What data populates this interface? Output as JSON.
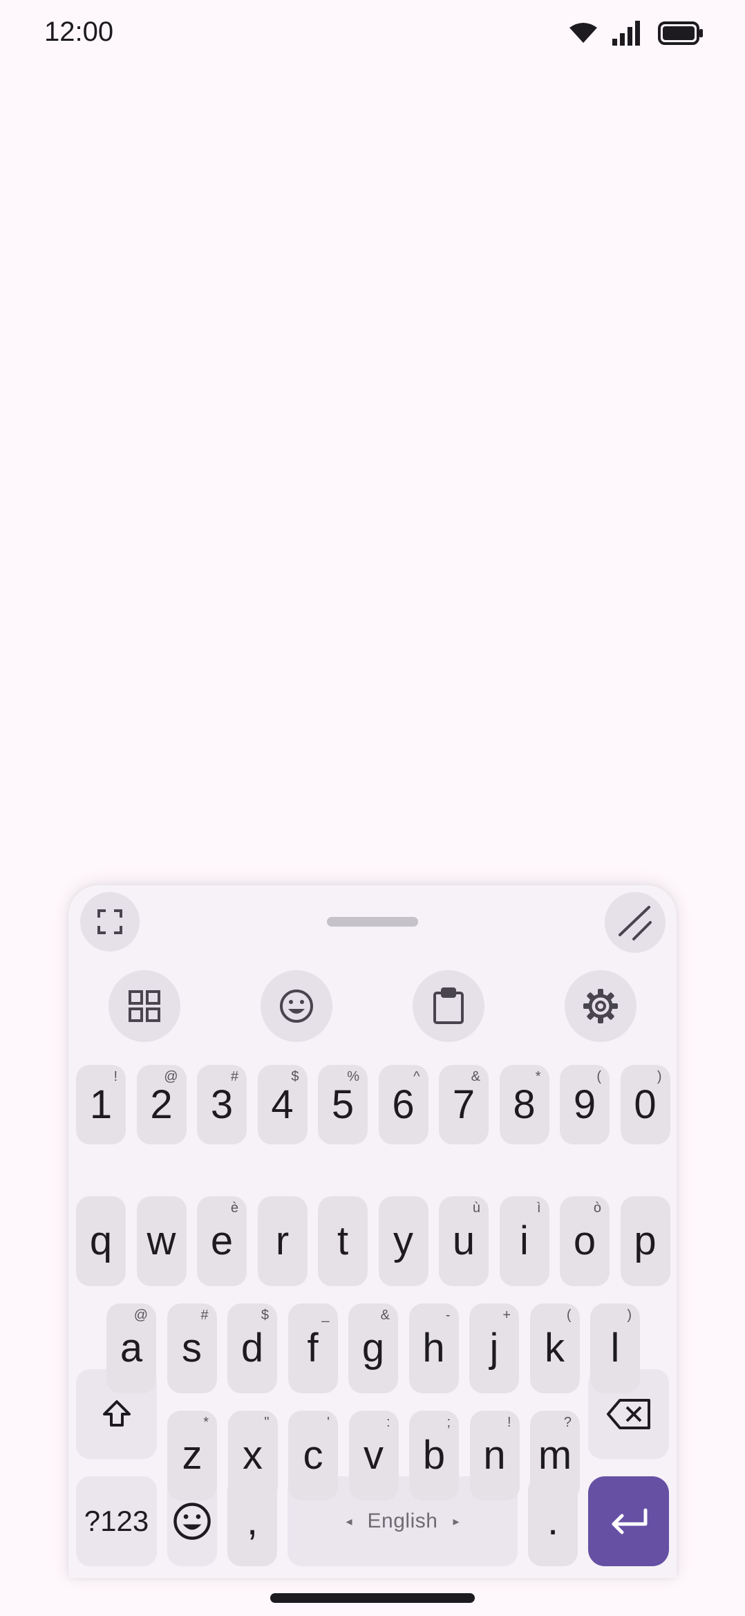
{
  "status_bar": {
    "time": "12:00",
    "icons": [
      "wifi-icon",
      "cellular-signal-icon",
      "battery-icon"
    ]
  },
  "keyboard": {
    "toolbar": {
      "fullscreen": "fullscreen-icon",
      "resize": "resize-corner-icon",
      "quick_actions": [
        "apps-grid-icon",
        "emoji-icon",
        "clipboard-icon",
        "settings-gear-icon"
      ]
    },
    "rows": [
      [
        {
          "key": "1",
          "hint": "!"
        },
        {
          "key": "2",
          "hint": "@"
        },
        {
          "key": "3",
          "hint": "#"
        },
        {
          "key": "4",
          "hint": "$"
        },
        {
          "key": "5",
          "hint": "%"
        },
        {
          "key": "6",
          "hint": "^"
        },
        {
          "key": "7",
          "hint": "&"
        },
        {
          "key": "8",
          "hint": "*"
        },
        {
          "key": "9",
          "hint": "("
        },
        {
          "key": "0",
          "hint": ")"
        }
      ],
      [
        {
          "key": "q",
          "hint": ""
        },
        {
          "key": "w",
          "hint": ""
        },
        {
          "key": "e",
          "hint": "è"
        },
        {
          "key": "r",
          "hint": ""
        },
        {
          "key": "t",
          "hint": ""
        },
        {
          "key": "y",
          "hint": ""
        },
        {
          "key": "u",
          "hint": "ù"
        },
        {
          "key": "i",
          "hint": "ì"
        },
        {
          "key": "o",
          "hint": "ò"
        },
        {
          "key": "p",
          "hint": ""
        }
      ],
      [
        {
          "key": "a",
          "hint": "@"
        },
        {
          "key": "s",
          "hint": "#"
        },
        {
          "key": "d",
          "hint": "$"
        },
        {
          "key": "f",
          "hint": "_"
        },
        {
          "key": "g",
          "hint": "&"
        },
        {
          "key": "h",
          "hint": "-"
        },
        {
          "key": "j",
          "hint": "+"
        },
        {
          "key": "k",
          "hint": "("
        },
        {
          "key": "l",
          "hint": ")"
        }
      ],
      [
        {
          "key": "z",
          "hint": "*"
        },
        {
          "key": "x",
          "hint": "\""
        },
        {
          "key": "c",
          "hint": "'"
        },
        {
          "key": "v",
          "hint": ":"
        },
        {
          "key": "b",
          "hint": ";"
        },
        {
          "key": "n",
          "hint": "!"
        },
        {
          "key": "m",
          "hint": "?"
        }
      ]
    ],
    "shift": "shift-icon",
    "backspace": "backspace-icon",
    "bottom_row": {
      "symbols_label": "?123",
      "emoji": "emoji-icon",
      "comma": {
        "key": ",",
        "hint": "!"
      },
      "space_label": "English",
      "space_left_arrow": "◂",
      "space_right_arrow": "▸",
      "period": {
        "key": ".",
        "hint": "…"
      },
      "enter": "enter-return-icon"
    },
    "colors": {
      "panel_bg": "#f6f2f7",
      "key_bg": "#e6e1e6",
      "accent": "#6650a4",
      "page_bg": "#fef7fb"
    }
  }
}
